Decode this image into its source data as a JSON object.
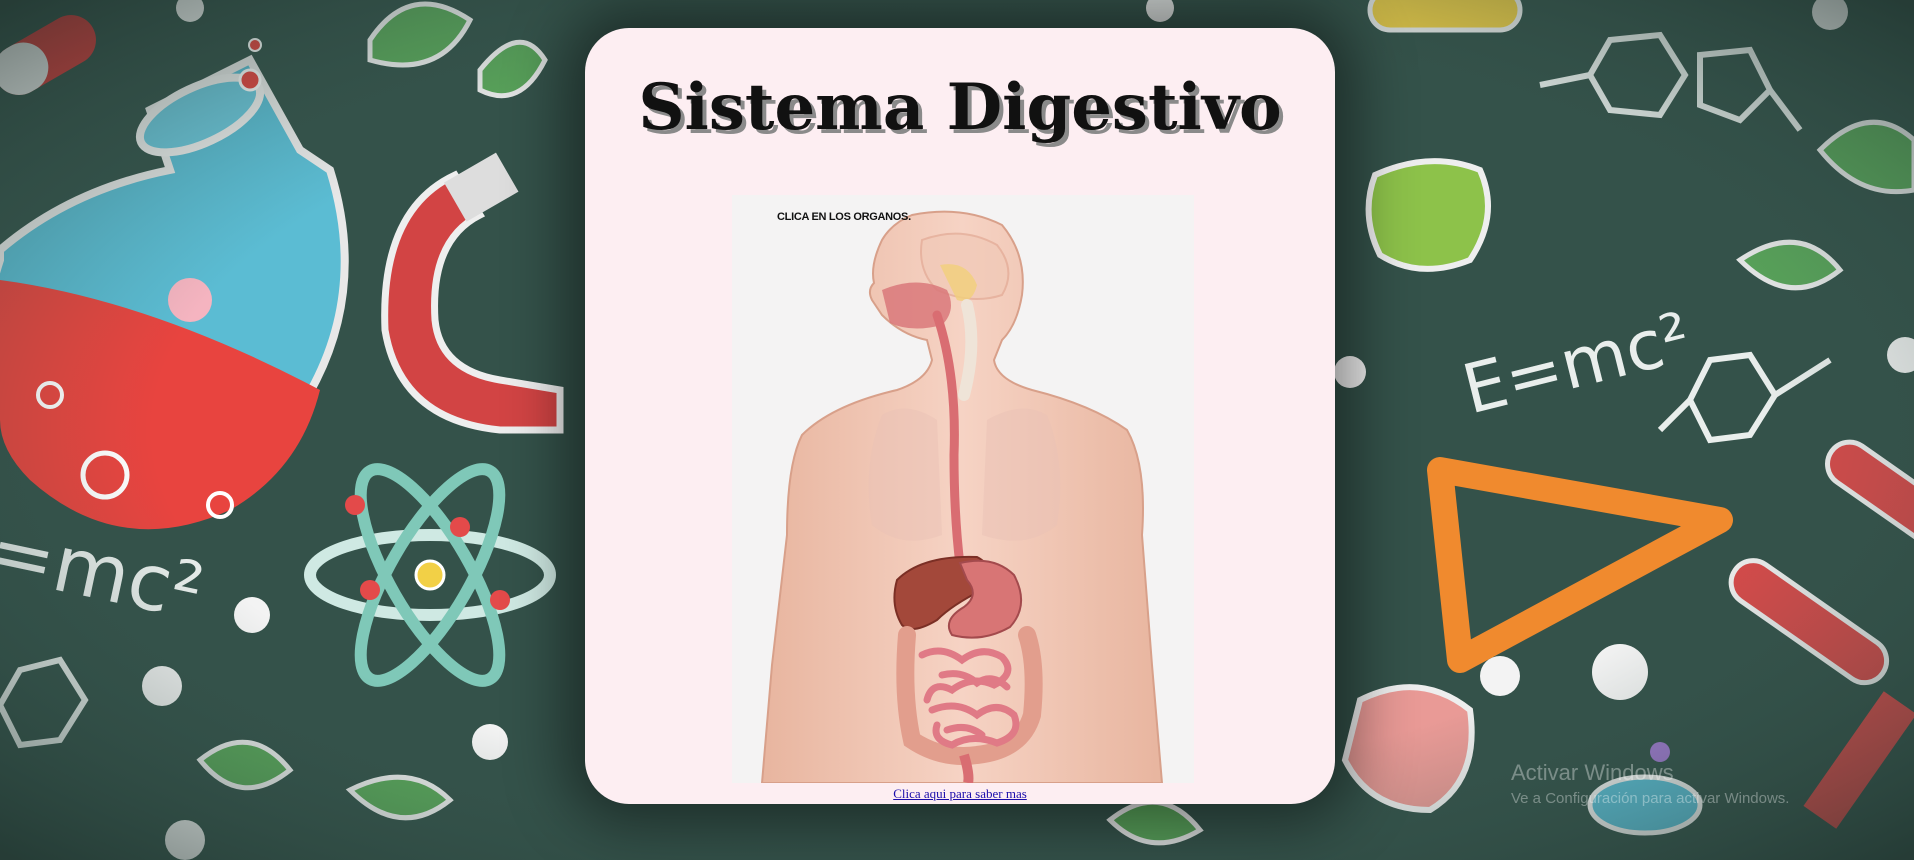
{
  "page": {
    "title": "Sistema Digestivo"
  },
  "diagram": {
    "instruction": "CLICA EN LOS ORGANOS."
  },
  "link": {
    "label": "Clica aqui para saber mas"
  },
  "watermark": {
    "title": "Activar Windows",
    "subtitle": "Ve a Configuración para activar Windows."
  },
  "colors": {
    "card_background": "#fdeef2",
    "chalkboard": "#2f4a42",
    "link": "#1a0dab"
  },
  "icons": [
    "flask-icon",
    "magnet-icon",
    "atom-icon",
    "leaf-icon",
    "molecule-icon",
    "ruler-icon",
    "test-tube-icon",
    "microbe-icon",
    "pill-icon"
  ]
}
